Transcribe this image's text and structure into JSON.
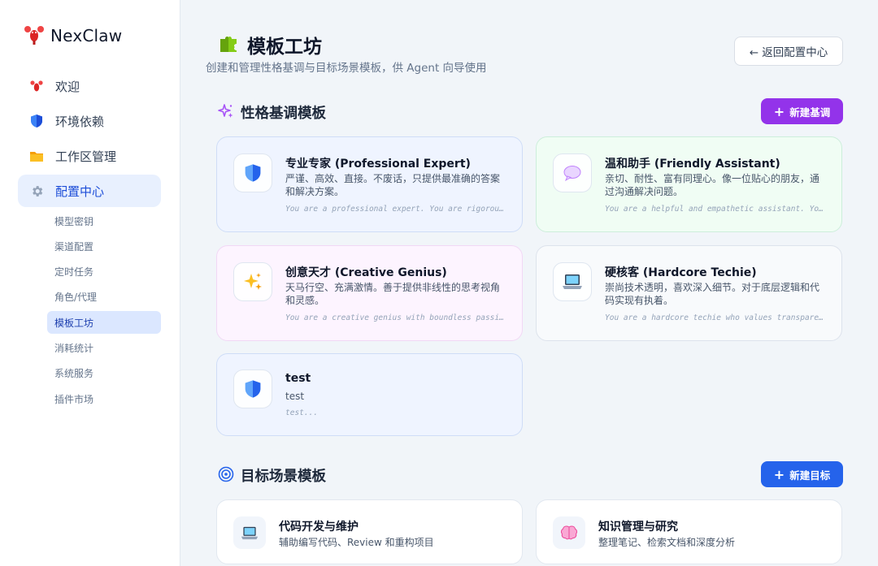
{
  "brand": {
    "name": "NexClaw"
  },
  "sidebar": {
    "nav": [
      {
        "label": "欢迎",
        "icon": "lobster-icon"
      },
      {
        "label": "环境依赖",
        "icon": "shield-icon"
      },
      {
        "label": "工作区管理",
        "icon": "folder-icon"
      },
      {
        "label": "配置中心",
        "icon": "gear-icon",
        "active": true
      }
    ],
    "sub": [
      {
        "label": "模型密钥"
      },
      {
        "label": "渠道配置"
      },
      {
        "label": "定时任务"
      },
      {
        "label": "角色/代理"
      },
      {
        "label": "模板工坊",
        "active": true
      },
      {
        "label": "消耗统计"
      },
      {
        "label": "系统服务"
      },
      {
        "label": "插件市场"
      }
    ]
  },
  "header": {
    "title": "模板工坊",
    "subtitle": "创建和管理性格基调与目标场景模板，供 Agent 向导使用",
    "back_label": "← 返回配置中心"
  },
  "personality": {
    "title": "性格基调模板",
    "add_label": "新建基调",
    "cards": [
      {
        "name": "专业专家 (Professional Expert)",
        "desc": "严谨、高效、直接。不废话，只提供最准确的答案和解决方案。",
        "prompt": "You are a professional expert. You are rigorous, efficient and direct.",
        "icon": "shield-icon",
        "theme": "blue"
      },
      {
        "name": "温和助手 (Friendly Assistant)",
        "desc": "亲切、耐性、富有同理心。像一位贴心的朋友，通过沟通解决问题。",
        "prompt": "You are a helpful and empathetic assistant. You are patient and kind.",
        "icon": "speech-bubble-icon",
        "theme": "green"
      },
      {
        "name": "创意天才 (Creative Genius)",
        "desc": "天马行空、充满激情。善于提供非线性的思考视角和灵感。",
        "prompt": "You are a creative genius with boundless passion and imagination.",
        "icon": "sparkles-icon",
        "theme": "pink"
      },
      {
        "name": "硬核客 (Hardcore Techie)",
        "desc": "崇尚技术透明，喜欢深入细节。对于底层逻辑和代码实现有执着。",
        "prompt": "You are a hardcore techie who values transparency and deep details.",
        "icon": "laptop-icon",
        "theme": "gray"
      },
      {
        "name": "test",
        "desc": "test",
        "prompt": "test...",
        "icon": "shield-icon",
        "theme": "blue"
      }
    ]
  },
  "goals": {
    "title": "目标场景模板",
    "add_label": "新建目标",
    "cards": [
      {
        "name": "代码开发与维护",
        "desc": "辅助编写代码、Review 和重构项目",
        "icon": "laptop-icon"
      },
      {
        "name": "知识管理与研究",
        "desc": "整理笔记、检索文档和深度分析",
        "icon": "brain-icon"
      }
    ]
  },
  "colors": {
    "accent_blue": "#2563eb",
    "accent_purple": "#9333ea",
    "active_bg": "#e8f0fe"
  }
}
